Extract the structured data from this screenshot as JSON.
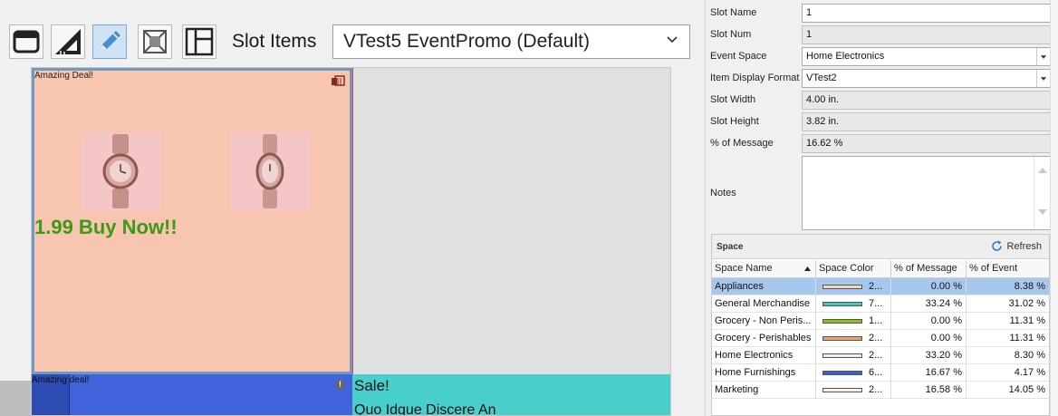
{
  "toolbar": {
    "buttons": [
      {
        "name": "window-layout-icon"
      },
      {
        "name": "triangle-ruler-icon"
      },
      {
        "name": "pencil-edit-icon"
      },
      {
        "name": "fit-expand-icon"
      },
      {
        "name": "panel-layout-icon"
      }
    ],
    "slot_items_label": "Slot Items",
    "slot_select_value": "VTest5 EventPromo (Default)"
  },
  "canvas": {
    "slot1": {
      "tag": "Amazing Deal!",
      "promo": "1.99 Buy Now!!"
    },
    "slot2": {
      "tag": "Amazing deal!",
      "alert": "!"
    },
    "slot3": {
      "line1": "Sale!",
      "line2": "Quo Idque Discere An"
    }
  },
  "properties": {
    "slot_name": {
      "label": "Slot Name",
      "value": "1"
    },
    "slot_num": {
      "label": "Slot Num",
      "value": "1"
    },
    "event_space": {
      "label": "Event Space",
      "value": "Home Electronics"
    },
    "item_display_format": {
      "label": "Item Display Format",
      "value": "VTest2"
    },
    "slot_width": {
      "label": "Slot Width",
      "value": "4.00 in."
    },
    "slot_height": {
      "label": "Slot Height",
      "value": "3.82 in."
    },
    "pct_message": {
      "label": "% of Message",
      "value": "16.62 %"
    },
    "notes": {
      "label": "Notes",
      "value": ""
    }
  },
  "space_grid": {
    "title": "Space",
    "refresh_label": "Refresh",
    "columns": [
      "Space Name",
      "Space Color",
      "% of Message",
      "% of Event"
    ],
    "rows": [
      {
        "name": "Appliances",
        "color": "#f2d8b6",
        "color_text": "2...",
        "pct_message": "0.00 %",
        "pct_event": "8.38 %",
        "selected": true
      },
      {
        "name": "General Merchandise",
        "color": "#3fc8c0",
        "color_text": "7...",
        "pct_message": "33.24 %",
        "pct_event": "31.02 %",
        "selected": false
      },
      {
        "name": "Grocery - Non Peris...",
        "color": "#8bc11e",
        "color_text": "1...",
        "pct_message": "0.00 %",
        "pct_event": "11.31 %",
        "selected": false
      },
      {
        "name": "Grocery - Perishables",
        "color": "#f0a068",
        "color_text": "2...",
        "pct_message": "0.00 %",
        "pct_event": "11.31 %",
        "selected": false
      },
      {
        "name": "Home Electronics",
        "color": "#f2f2e4",
        "color_text": "2...",
        "pct_message": "33.20 %",
        "pct_event": "8.30 %",
        "selected": false
      },
      {
        "name": "Home Furnishings",
        "color": "#3e5fcf",
        "color_text": "6...",
        "pct_message": "16.67 %",
        "pct_event": "4.17 %",
        "selected": false
      },
      {
        "name": "Marketing",
        "color": "#f7f0e0",
        "color_text": "2...",
        "pct_message": "16.58 %",
        "pct_event": "14.05 %",
        "selected": false
      }
    ]
  }
}
